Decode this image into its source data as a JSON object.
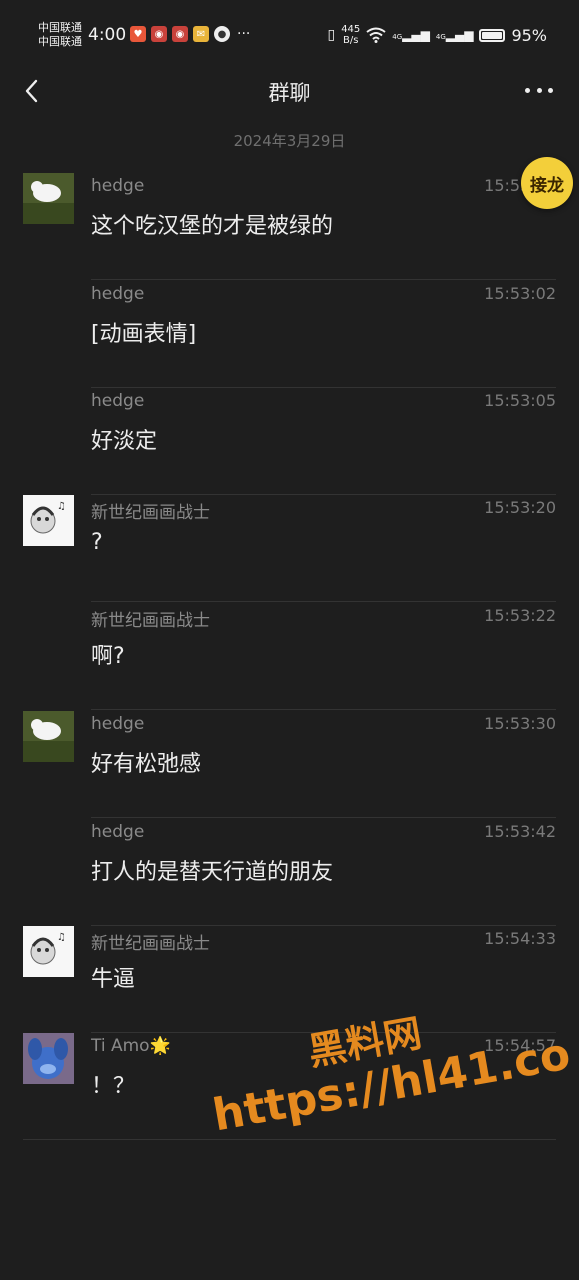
{
  "status_bar": {
    "carrier1": "中国联通",
    "carrier2": "中国联通",
    "time": "4:00",
    "net_speed_value": "445",
    "net_speed_unit": "B/s",
    "sig1": "4G",
    "sig2": "4G",
    "battery_pct": "95%"
  },
  "nav": {
    "title": "群聊"
  },
  "date_divider": "2024年3月29日",
  "relay_button": "接龙",
  "messages": [
    {
      "sender": "hedge",
      "time": "15:53:00",
      "text": "这个吃汉堡的才是被绿的"
    },
    {
      "sender": "hedge",
      "time": "15:53:02",
      "text": "[动画表情]"
    },
    {
      "sender": "hedge",
      "time": "15:53:05",
      "text": "好淡定"
    },
    {
      "sender": "新世纪画画战士",
      "time": "15:53:20",
      "text": "?"
    },
    {
      "sender": "新世纪画画战士",
      "time": "15:53:22",
      "text": "啊?"
    },
    {
      "sender": "hedge",
      "time": "15:53:30",
      "text": "好有松弛感"
    },
    {
      "sender": "hedge",
      "time": "15:53:42",
      "text": "打人的是替天行道的朋友"
    },
    {
      "sender": "新世纪画画战士",
      "time": "15:54:33",
      "text": "牛逼"
    },
    {
      "sender": "Ti Amo🌟",
      "time": "15:54:57",
      "text": "！？"
    }
  ],
  "watermark": {
    "line1": "黑料网",
    "line2": "https://hl41.co"
  }
}
